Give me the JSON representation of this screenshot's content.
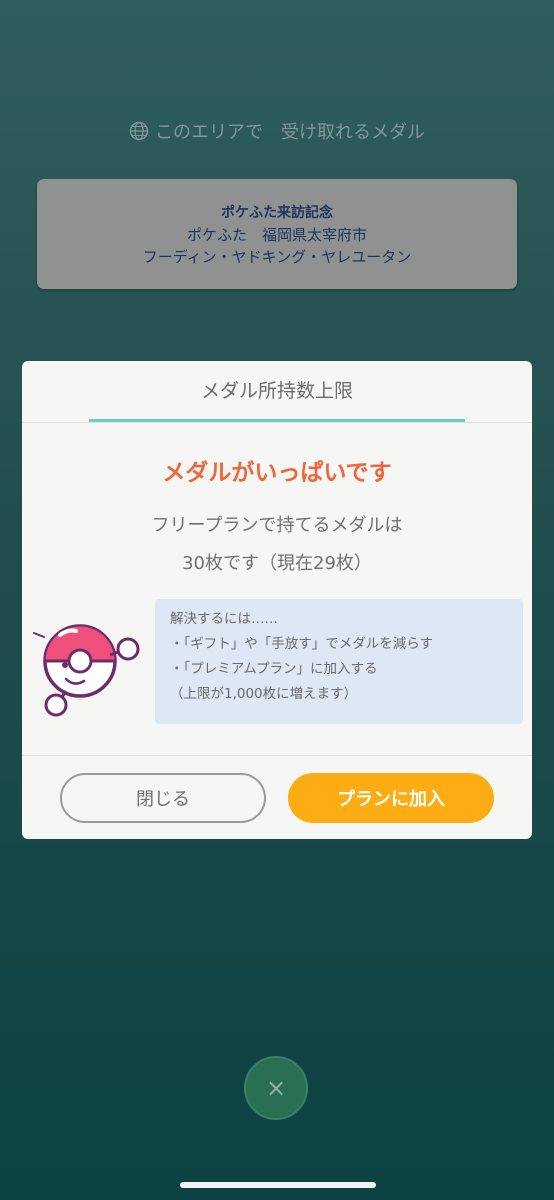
{
  "header": {
    "area_medals_label": "このエリアで　受け取れるメダル",
    "icon": "globe-icon"
  },
  "medal_card": {
    "line1": "ポケふた来訪記念",
    "line2": "ポケふた　福岡県太宰府市",
    "line3": "フーディン・ヤドキング・ヤレユータン"
  },
  "dialog": {
    "title": "メダル所持数上限",
    "heading": "メダルがいっぱいです",
    "message_line1": "フリープランで持てるメダルは",
    "message_line2": "30枚です（現在29枚）",
    "solution": {
      "intro": "解決するには……",
      "item1": "・「ギフト」や「手放す」でメダルを減らす",
      "item2": "・「プレミアムプラン」に加入する",
      "note": "（上限が1,000枚に増えます）"
    },
    "close_button": "閉じる",
    "join_button": "プランに加入"
  },
  "bottom": {
    "close_icon": "×"
  },
  "colors": {
    "accent_orange": "#f0653b",
    "join_button": "#fdac13",
    "tab_underline": "#67cfc4",
    "solution_bg": "#dde8f4"
  }
}
